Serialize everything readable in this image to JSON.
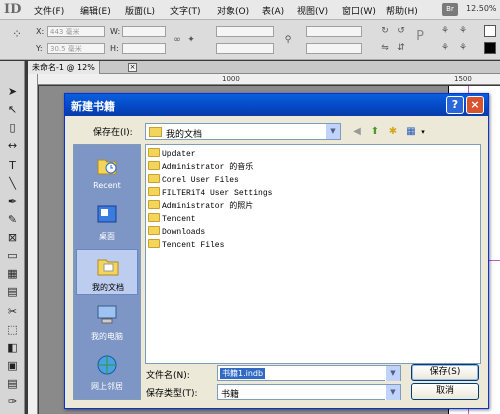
{
  "menubar": {
    "logo": "ID",
    "items": [
      "文件(F)",
      "编辑(E)",
      "版面(L)",
      "文字(T)",
      "对象(O)",
      "表(A)",
      "视图(V)",
      "窗口(W)",
      "帮助(H)"
    ],
    "bridge": "Br",
    "zoom": "12.50%"
  },
  "controlbar": {
    "x_label": "X:",
    "y_label": "Y:",
    "w_label": "W:",
    "h_label": "H:",
    "x_value": "443 毫米",
    "y_value": "30.5 毫米"
  },
  "document": {
    "tab_title": "未命名-1 @ 12%",
    "ruler_labels": [
      "1000",
      "1500"
    ]
  },
  "dialog": {
    "title": "新建书籍",
    "lookin_label": "保存在(I):",
    "lookin_value": "我的文档",
    "places": [
      "Recent",
      "桌面",
      "我的文档",
      "我的电脑",
      "网上邻居"
    ],
    "files": [
      "Updater",
      "Administrator 的音乐",
      "Corel User Files",
      "FILTERiT4 User Settings",
      "Administrator 的照片",
      "Tencent",
      "Downloads",
      "Tencent Files"
    ],
    "filename_label": "文件名(N):",
    "filename_value": "书籍1.indb",
    "filetype_label": "保存类型(T):",
    "filetype_value": "书籍",
    "save_button": "保存(S)",
    "cancel_button": "取消"
  }
}
